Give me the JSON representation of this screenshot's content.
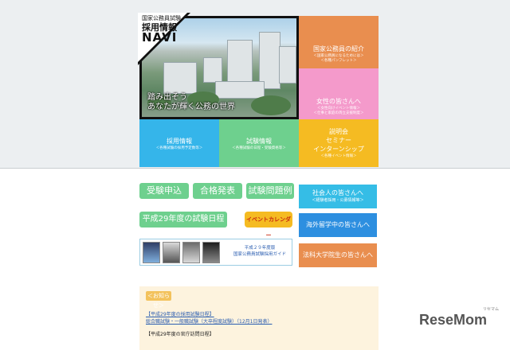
{
  "logo": {
    "line1": "国家公務員試験",
    "line2": "採用情報",
    "line3": "NAVI"
  },
  "hero": {
    "tagline1": "踏み出そう",
    "tagline2": "あなたが輝く公務の世界"
  },
  "tiles": {
    "intro": {
      "title": "国家公務員の紹介",
      "sub1": "＜国家公務員になるためには＞",
      "sub2": "＜各種パンフレット＞"
    },
    "women": {
      "title": "女性の皆さんへ",
      "sub1": "＜女性向けイベント情報＞",
      "sub2": "＜仕事と家庭の両立支援制度＞"
    },
    "recruit": {
      "title": "採用情報",
      "sub1": "＜各種試験の採用予定数等＞"
    },
    "exam": {
      "title": "試験情報",
      "sub1": "＜各種試験の日程・受験資格等＞"
    },
    "events": {
      "title1": "説明会",
      "title2": "セミナー",
      "title3": "インターンシップ",
      "sub1": "＜各種イベント情報＞"
    }
  },
  "pills": {
    "apply": "受験申込",
    "results": "合格発表",
    "past_exams": "試験問題例"
  },
  "schedule": "平成29年度の試験日程",
  "calendar": "イベントカレンダー",
  "right_buttons": {
    "working": {
      "title": "社会人の皆さんへ",
      "sub": "＜経験者採用・公募情報等＞"
    },
    "abroad": "海外留学中の皆さんへ",
    "law": "法科大学院生の皆さんへ"
  },
  "pamphlet": {
    "line1": "平成２９年度版",
    "line2": "国家公務員試験採用ガイド"
  },
  "news": {
    "header": "＜お知らせ＞",
    "item1": "【平成29年度の採用試験日程】",
    "item2": "総合職試験・一般職試験（大卒程度試験）（12月1日発表）",
    "item3": "【平成29年度の官庁訪問日程】"
  },
  "watermark": "ReseMom",
  "watermark_sub": "リセマム",
  "colors": {
    "orange": "#e98e4f",
    "pink": "#f49acb",
    "blue": "#35b5ea",
    "green": "#6ed08e",
    "yellow": "#f5bb22"
  }
}
